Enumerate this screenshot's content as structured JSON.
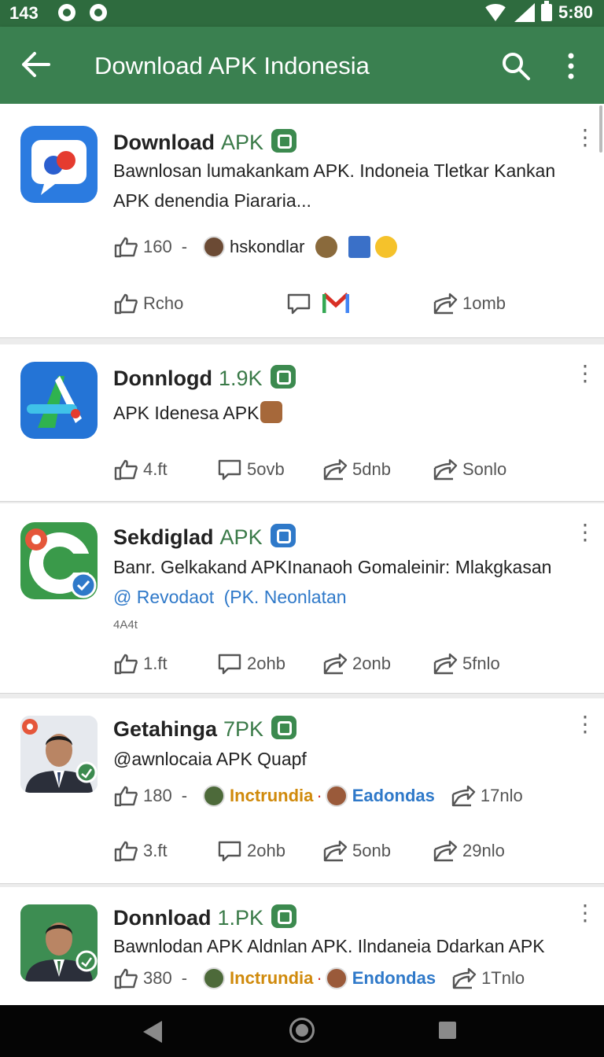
{
  "status": {
    "time": "143",
    "clock": "5:80"
  },
  "appbar": {
    "title": "Download APK Indonesia"
  },
  "posts": [
    {
      "name": "Download",
      "tag": "APK",
      "desc": "Bawnlosan lumakankam APK. Indoneia Tletkar Kankan APK denendia Piararia...",
      "meta_count": "160",
      "meta_sep": "-",
      "meta_user": "hskondlar",
      "actions": [
        "Rcho",
        "",
        "",
        "1omb"
      ]
    },
    {
      "name": "Donnlogd",
      "tag": "1.9K",
      "desc": "APK Idenesa APK",
      "actions": [
        "4.ft",
        "5ovb",
        "5dnb",
        "Sonlo"
      ]
    },
    {
      "name": "Sekdiglad",
      "tag": "APK",
      "desc": "Banr. Gelkakand APKInanaoh Gomaleinir: Mlakgkasan",
      "mention": "@ Revodaot",
      "link": "(PK. Neonlatan",
      "small": "4A4t",
      "actions": [
        "1.ft",
        "2ohb",
        "2onb",
        "5fnlo"
      ]
    },
    {
      "name": "Getahinga",
      "tag": "7PK",
      "desc": "@awnlocaia APK Quapf",
      "meta_count": "180",
      "meta_sep": "-",
      "meta_user1": "Inctrundia",
      "meta_user2": "Eadondas",
      "meta_share": "17nlo",
      "actions": [
        "3.ft",
        "2ohb",
        "5onb",
        "29nlo"
      ]
    },
    {
      "name": "Donnload",
      "tag": "1.PK",
      "desc": "Bawnlodan APK Aldnlan APK. Ilndaneia Ddarkan APK",
      "meta_count": "380",
      "meta_sep": "-",
      "meta_user1": "Inctrundia",
      "meta_user2": "Endondas",
      "meta_share": "1Tnlo"
    }
  ],
  "colors": {
    "appbar": "#3a8050",
    "statusbar": "#2e6b3e",
    "badge": "#3c8a4f",
    "link_blue": "#2f79c9",
    "link_orange": "#d08a0c"
  }
}
